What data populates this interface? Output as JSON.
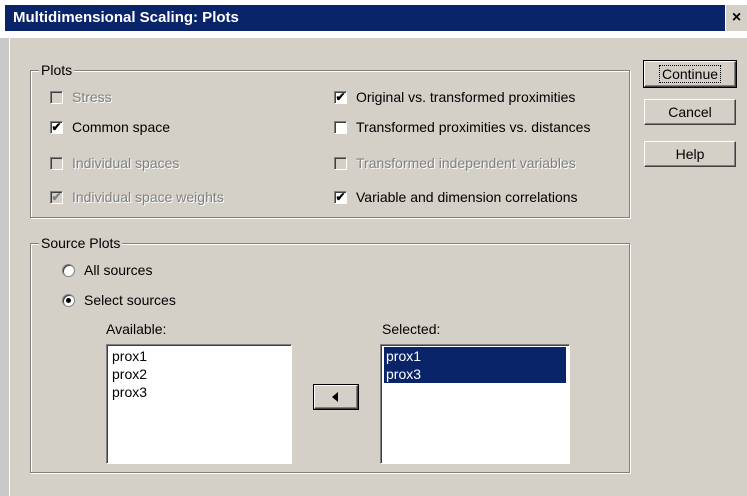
{
  "window": {
    "title": "Multidimensional Scaling: Plots",
    "close_glyph": "×"
  },
  "plots_group": {
    "label": "Plots",
    "options": [
      {
        "label": "Stress",
        "checked": false,
        "enabled": false
      },
      {
        "label": "Common space",
        "checked": true,
        "enabled": true
      },
      {
        "label": "Individual spaces",
        "checked": false,
        "enabled": false
      },
      {
        "label": "Individual space weights",
        "checked": true,
        "enabled": false
      },
      {
        "label": "Original vs. transformed proximities",
        "checked": true,
        "enabled": true
      },
      {
        "label": "Transformed proximities vs. distances",
        "checked": false,
        "enabled": true
      },
      {
        "label": "Transformed independent variables",
        "checked": false,
        "enabled": false
      },
      {
        "label": "Variable and dimension correlations",
        "checked": true,
        "enabled": true
      }
    ]
  },
  "source_group": {
    "label": "Source Plots",
    "radios": [
      {
        "label": "All sources",
        "selected": false
      },
      {
        "label": "Select sources",
        "selected": true
      }
    ],
    "available": {
      "label": "Available:",
      "items": [
        "prox1",
        "prox2",
        "prox3"
      ]
    },
    "selected": {
      "label": "Selected:",
      "items": [
        "prox1",
        "prox3"
      ]
    },
    "move_button_icon": "left-arrow-icon"
  },
  "buttons": {
    "continue": "Continue",
    "cancel": "Cancel",
    "help": "Help"
  },
  "colors": {
    "face": "#d4d0c8",
    "titlebar": "#0a246a",
    "selection": "#0a246a"
  }
}
